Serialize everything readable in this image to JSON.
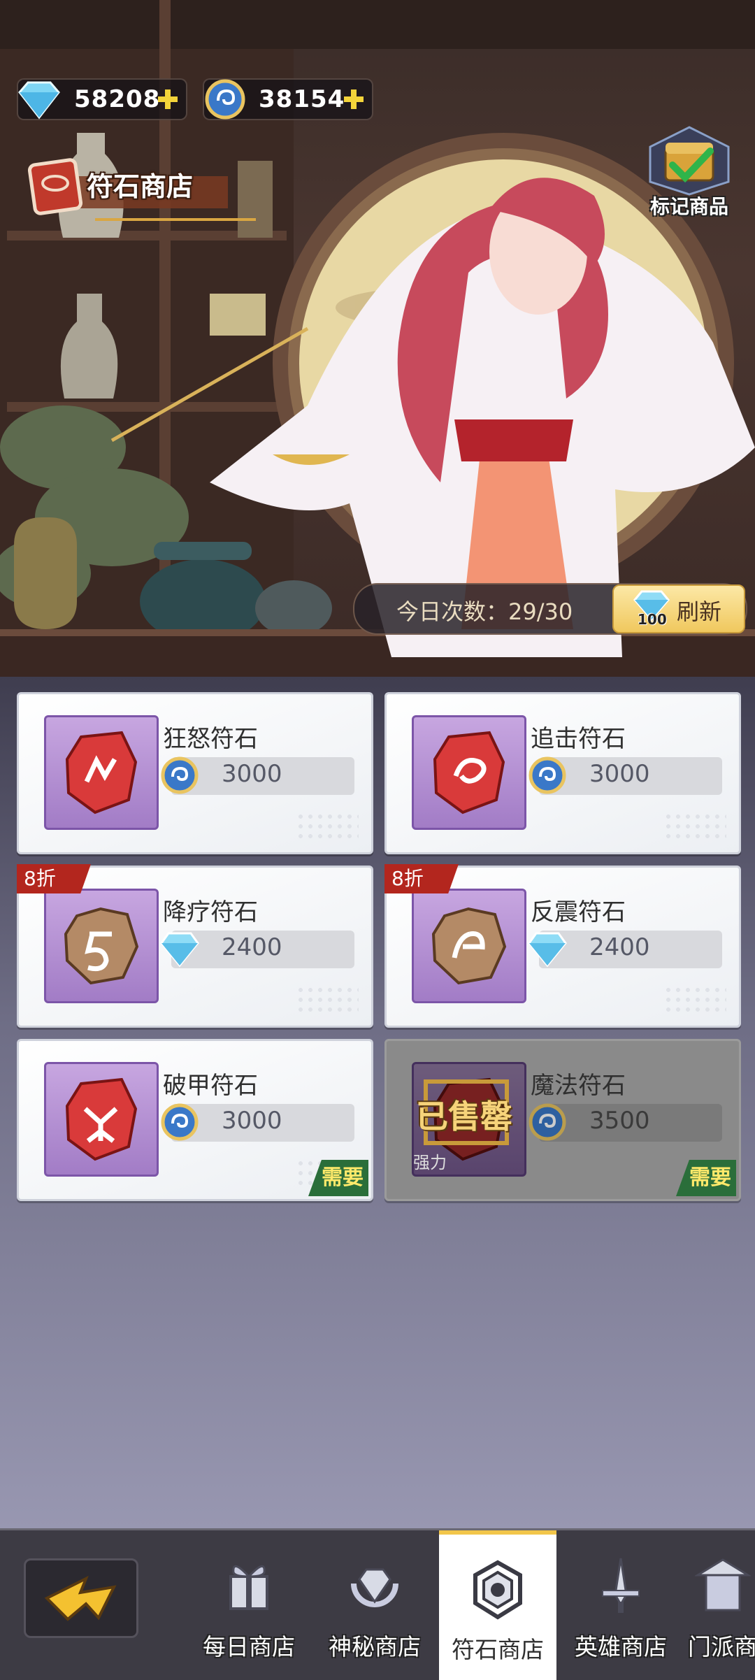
{
  "currencies": {
    "gems": {
      "value": "58208",
      "icon": "diamond-icon"
    },
    "coins": {
      "value": "38154",
      "icon": "rune-coin-icon"
    }
  },
  "shop_title": "符石商店",
  "mark_items_label": "标记商品",
  "daily_count": "今日次数：29/30",
  "refresh": {
    "label": "刷新",
    "cost": "100"
  },
  "items": [
    {
      "name": "狂怒符石",
      "price": "3000",
      "currency": "coin",
      "discount": "",
      "need": "",
      "sold": "",
      "color": "#d93a3a"
    },
    {
      "name": "追击符石",
      "price": "3000",
      "currency": "coin",
      "discount": "",
      "need": "",
      "sold": "",
      "color": "#d93a3a"
    },
    {
      "name": "降疗符石",
      "price": "2400",
      "currency": "gem",
      "discount": "8折",
      "need": "",
      "sold": "",
      "color": "#b48a66"
    },
    {
      "name": "反震符石",
      "price": "2400",
      "currency": "gem",
      "discount": "8折",
      "need": "",
      "sold": "",
      "color": "#b48a66"
    },
    {
      "name": "破甲符石",
      "price": "3000",
      "currency": "coin",
      "discount": "",
      "need": "需要",
      "sold": "",
      "color": "#d93a3a"
    },
    {
      "name": "魔法符石",
      "price": "3500",
      "currency": "coin",
      "discount": "",
      "need": "需要",
      "sold": "已售罄",
      "strength": "强力",
      "color": "#d93a3a"
    }
  ],
  "nav": {
    "tabs": [
      {
        "label": "每日商店",
        "icon": "gift-icon",
        "active": false
      },
      {
        "label": "神秘商店",
        "icon": "diamond-moon-icon",
        "active": false
      },
      {
        "label": "符石商店",
        "icon": "rune-icon",
        "active": true
      },
      {
        "label": "英雄商店",
        "icon": "sword-icon",
        "active": false
      },
      {
        "label": "门派商",
        "icon": "pavilion-icon",
        "active": false
      }
    ]
  }
}
